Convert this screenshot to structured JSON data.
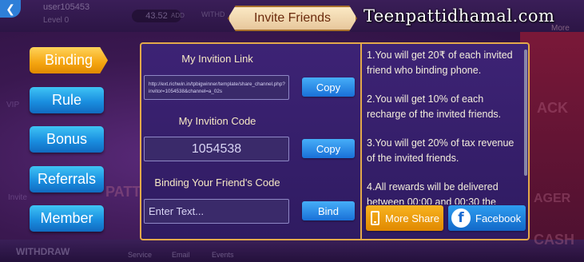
{
  "header": {
    "back_icon": "back-arrow-icon",
    "user_id": "user105453",
    "user_level": "Level 0",
    "balance": "43.52",
    "add_label": "ADD",
    "withdraw_label": "WITHD",
    "more_label": "More"
  },
  "title": "Invite Friends",
  "watermark": "Teenpattidhamal.com",
  "tabs": [
    {
      "label": "Binding",
      "active": true
    },
    {
      "label": "Rule",
      "active": false
    },
    {
      "label": "Bonus",
      "active": false
    },
    {
      "label": "Referrals",
      "active": false
    },
    {
      "label": "Member",
      "active": false
    }
  ],
  "invite": {
    "link_title": "My Invition Link",
    "link_value": "http://ext.richwin.in/tpbigwinner/template/share_channel.php?invitor=1054538&channel=a_02s",
    "copy_label": "Copy",
    "code_title": "My Invition Code",
    "code_value": "1054538",
    "copy_code_label": "Copy",
    "binding_title": "Binding Your Friend's Code",
    "binding_placeholder": "Enter Text...",
    "bind_label": "Bind"
  },
  "rules": [
    "1.You will get 20₹ of each invited friend who binding phone.",
    "2.You will get 10% of each recharge of the invited friends.",
    "3.You will get 20% of tax revenue of the invited friends.",
    "4.All rewards will be delivered between 00:00 and 00:30 the"
  ],
  "share": {
    "more_share_label": "More Share",
    "facebook_label": "Facebook"
  },
  "background": {
    "vip_label": "VIP",
    "invite_label": "Invite",
    "withdraw_label": "WITHDRAW",
    "bottom_items": [
      "Service",
      "Email",
      "Events"
    ],
    "side_words": [
      "ACK",
      "AGER",
      "CASH",
      "PATT"
    ]
  },
  "colors": {
    "panel_border": "#e3a94a",
    "tab_active": "#f5a511",
    "tab_blue": "#1a8fe0",
    "button_blue": "#1970d8",
    "more_share": "#f8b420",
    "facebook": "#1268c8"
  }
}
